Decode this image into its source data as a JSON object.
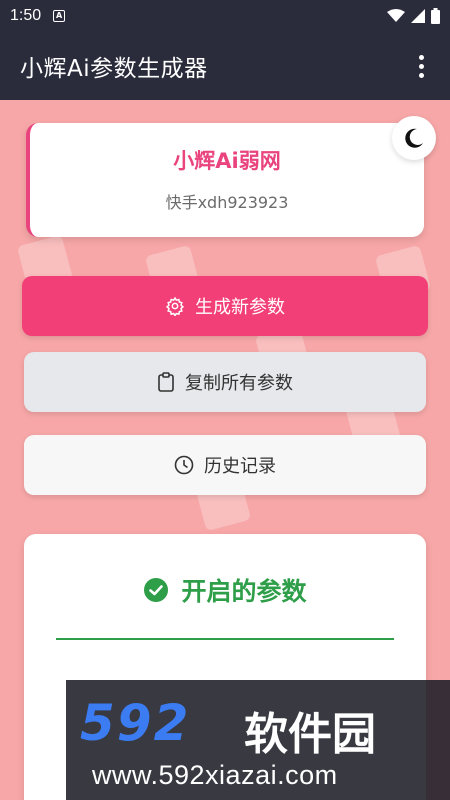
{
  "status": {
    "time": "1:50",
    "notification_icon": "a-square-icon",
    "wifi_icon": "wifi-icon",
    "signal_icon": "signal-icon",
    "battery_icon": "battery-icon"
  },
  "app_bar": {
    "title": "小辉Ai参数生成器",
    "menu_icon": "more-vert-icon"
  },
  "profile": {
    "name": "小辉Ai弱网",
    "subtitle": "快手xdh923923",
    "theme_toggle_icon": "moon-icon"
  },
  "actions": {
    "generate_label": "生成新参数",
    "generate_icon": "gear-icon",
    "copy_label": "复制所有参数",
    "copy_icon": "clipboard-icon",
    "history_label": "历史记录",
    "history_icon": "clock-icon"
  },
  "params": {
    "title": "开启的参数",
    "title_icon": "check-circle-icon"
  },
  "watermark": {
    "number": "592",
    "brand_cn": "软件园",
    "url": "www.592xiazai.com"
  },
  "colors": {
    "app_bar": "#2a2c3c",
    "background": "#f7a7a7",
    "accent_pink": "#f23f77",
    "name_pink": "#e9447d",
    "success_green": "#2e9e49"
  }
}
